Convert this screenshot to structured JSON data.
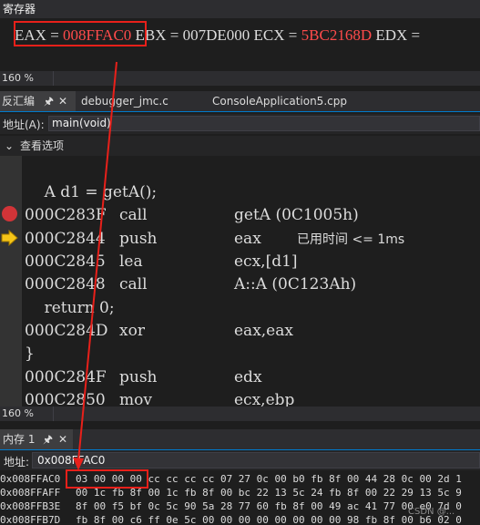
{
  "registers": {
    "title": "寄存器",
    "eax_label": "EAX = ",
    "eax_value": "008FFAC0",
    "ebx_text": " EBX = 007DE000 ECX = ",
    "ecx_value": "5BC2168D",
    "edx_text": " EDX = ",
    "zoom": "160 %"
  },
  "disasm": {
    "tab_label": "反汇编",
    "pin_icon": "pin-icon",
    "close_icon": "close-icon",
    "tabs": [
      "debugger_jmc.c",
      "ConsoleApplication5.cpp"
    ],
    "address_label": "地址(A):",
    "address_value": "main(void)",
    "view_options": "查看选项",
    "source_line": "    A d1 = getA();",
    "rows": [
      {
        "addr": "000C283F",
        "mnem": "call",
        "op": "getA (0C1005h)"
      },
      {
        "addr": "000C2844",
        "mnem": "push",
        "op": "eax"
      },
      {
        "addr": "000C2845",
        "mnem": "lea",
        "op": "ecx,[d1]"
      },
      {
        "addr": "000C2848",
        "mnem": "call",
        "op": "A::A (0C123Ah)"
      }
    ],
    "tooltip": "已用时间 <= 1ms",
    "return_line": "    return 0;",
    "rows2": [
      {
        "addr": "000C284D",
        "mnem": "xor",
        "op": "eax,eax"
      }
    ],
    "brace": "}",
    "rows3": [
      {
        "addr": "000C284F",
        "mnem": "push",
        "op": "edx"
      },
      {
        "addr": "000C2850",
        "mnem": "mov",
        "op": "ecx,ebp"
      }
    ],
    "zoom": "160 %"
  },
  "memory": {
    "tab_label": "内存 1",
    "address_label": "地址:",
    "address_value": "0x008FFAC0",
    "rows": [
      {
        "addr": "0x008FFAC0",
        "bytes": "03 00 00 00 cc cc cc cc 07 27 0c 00 b0 fb 8f 00 44 28 0c 00 2d 1"
      },
      {
        "addr": "0x008FFAFF",
        "bytes": "00 1c fb 8f 00 1c fb 8f 00 bc 22 13 5c 24 fb 8f 00 22 29 13 5c 9"
      },
      {
        "addr": "0x008FFB3E",
        "bytes": "8f 00 f5 bf 0c 5c 90 5a 28 77 60 fb 8f 00 49 ac 41 77 00 e0 7d 0"
      },
      {
        "addr": "0x008FFB7D",
        "bytes": "fb 8f 00 c6 ff 0e 5c 00 00 00 00 00 00 00 00 98 fb 8f 00 b6 02 0"
      }
    ]
  },
  "watermark": "CSDN @..."
}
